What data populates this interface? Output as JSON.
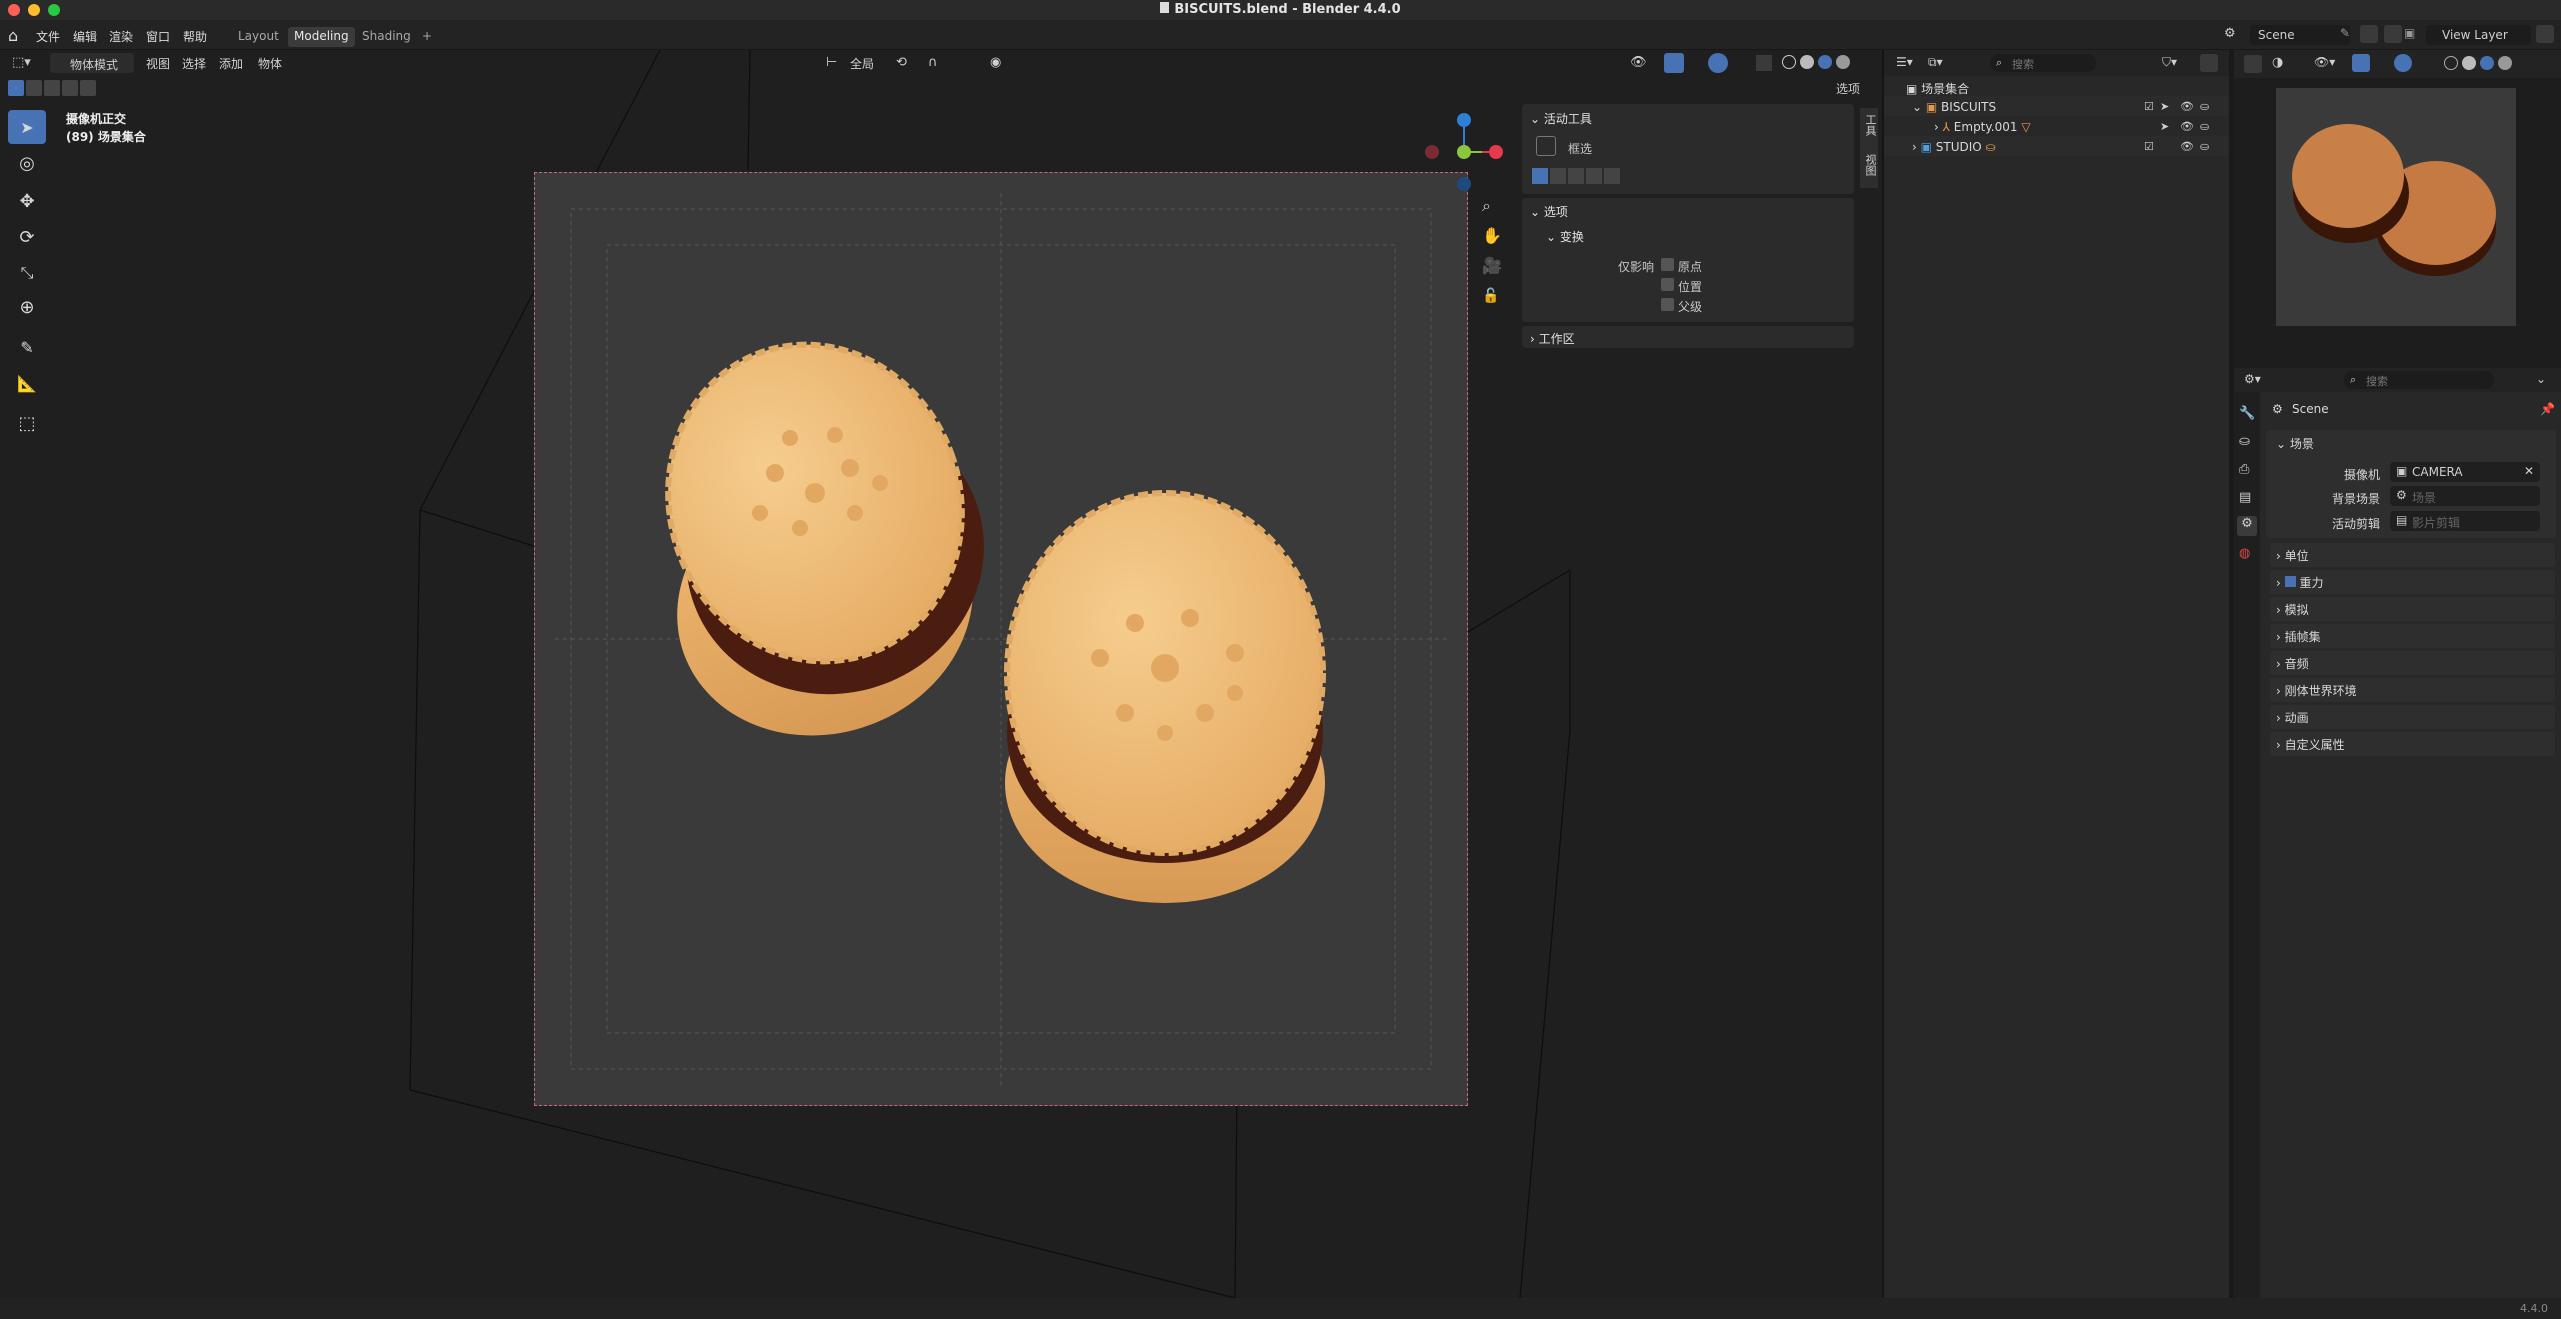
{
  "window": {
    "title": "BISCUITS.blend - Blender 4.4.0"
  },
  "menu": {
    "items": [
      "文件",
      "编辑",
      "渲染",
      "窗口",
      "帮助"
    ]
  },
  "workspaces": {
    "tabs": [
      "Layout",
      "Modeling",
      "Shading"
    ],
    "active": "Modeling",
    "add_label": "+"
  },
  "viewport_header": {
    "mode": "物体模式",
    "menus": [
      "视图",
      "选择",
      "添加",
      "物体"
    ],
    "orientation": "全局",
    "options_label": "选项"
  },
  "viewport": {
    "view_name": "摄像机正交",
    "collection_label": "(89) 场景集合"
  },
  "npanel": {
    "active_tool": {
      "header": "活动工具",
      "tool_name": "框选"
    },
    "options": {
      "header": "选项",
      "transform_header": "变换",
      "affect_only_label": "仅影响",
      "checkboxes": [
        "原点",
        "位置",
        "父级"
      ]
    },
    "workspace": {
      "header": "工作区"
    },
    "tabs": [
      "工具",
      "视图"
    ]
  },
  "top_right": {
    "scene_name": "Scene",
    "view_layer": "View Layer"
  },
  "outliner": {
    "search_placeholder": "搜索",
    "root": "场景集合",
    "items": [
      {
        "label": "BISCUITS",
        "type": "collection"
      },
      {
        "label": "Empty.001",
        "type": "empty"
      },
      {
        "label": "STUDIO",
        "type": "collection"
      }
    ]
  },
  "properties": {
    "search_placeholder": "搜索",
    "context": "Scene",
    "section_scene": "场景",
    "camera_label": "摄像机",
    "camera_value": "CAMERA",
    "background_label": "背景场景",
    "background_placeholder": "场景",
    "clip_label": "活动剪辑",
    "clip_placeholder": "影片剪辑",
    "sections": [
      "单位",
      "重力",
      "模拟",
      "插帧集",
      "音频",
      "刚体世界环境",
      "动画",
      "自定义属性"
    ]
  },
  "status": {
    "version": "4.4.0"
  },
  "colors": {
    "accent": "#4772b3",
    "axis_x": "#e6394f",
    "axis_y": "#8cc63f",
    "axis_z": "#2f7fd8",
    "biscuit": "#f2c27e",
    "filling": "#4a1d10"
  }
}
